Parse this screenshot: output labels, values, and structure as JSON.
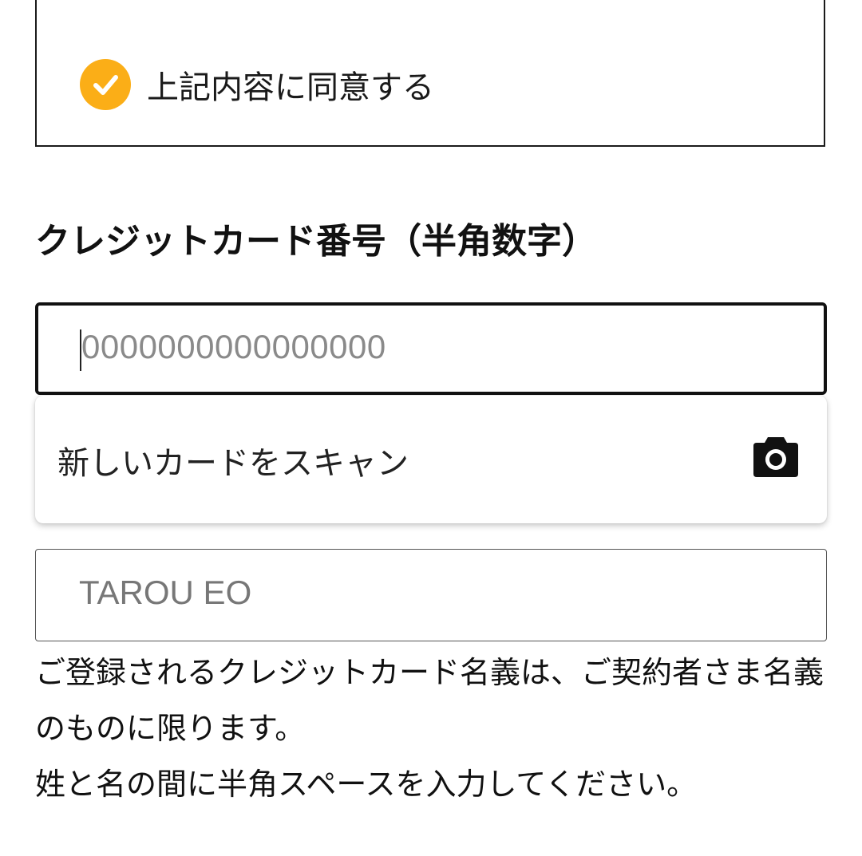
{
  "agreement": {
    "checked": true,
    "label": "上記内容に同意する",
    "check_color": "#fbae17"
  },
  "card_number": {
    "title": "クレジットカード番号（半角数字）",
    "placeholder": "0000000000000000"
  },
  "scan_suggestion": {
    "label": "新しいカードをスキャン",
    "icon": "camera-icon"
  },
  "card_name": {
    "placeholder": "TAROU EO"
  },
  "notes": {
    "line1": "ご登録されるクレジットカード名義は、ご契約者さま名義のものに限ります。",
    "line2": "姓と名の間に半角スペースを入力してください。"
  }
}
